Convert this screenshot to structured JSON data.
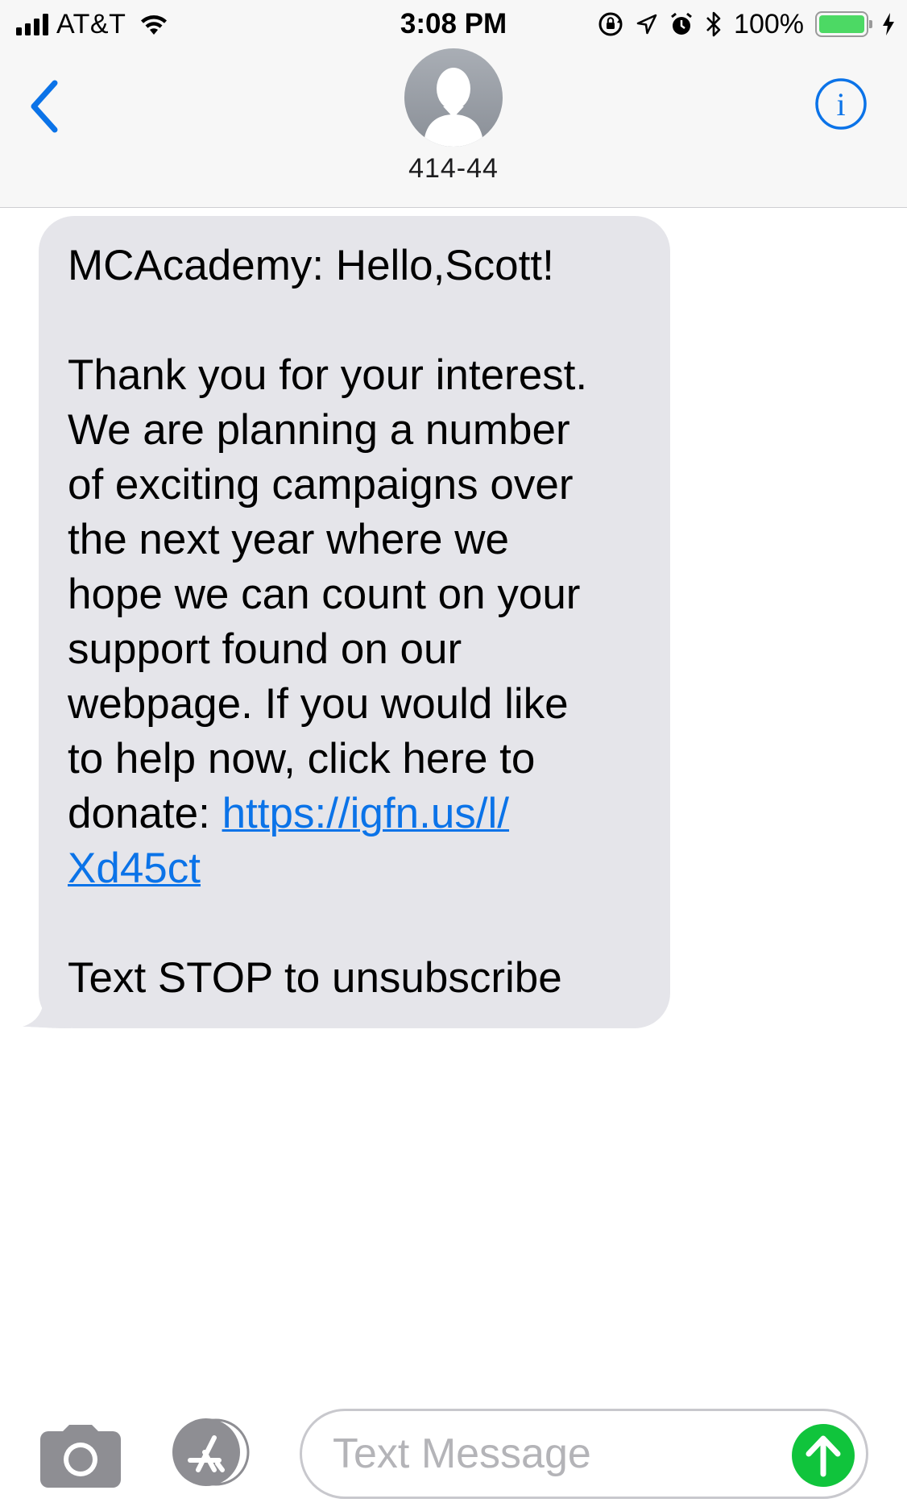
{
  "status_bar": {
    "carrier": "AT&T",
    "time": "3:08 PM",
    "battery_percent": "100%",
    "battery_level": 1.0,
    "icons": [
      "signal-icon",
      "wifi-icon",
      "rotation-lock-icon",
      "location-icon",
      "alarm-icon",
      "bluetooth-icon",
      "battery-icon",
      "charging-icon"
    ]
  },
  "nav": {
    "contact_name": "414-44",
    "back_icon": "chevron-left-icon",
    "info_icon": "info-icon",
    "avatar_icon": "person-silhouette-icon"
  },
  "message": {
    "sender_line": "MCAcademy: Hello,Scott!",
    "body_lines": [
      "Thank you for your interest.",
      "We are planning a number",
      "of exciting campaigns over",
      "the next year where we",
      "hope we can count on your",
      "support found on our",
      "webpage. If you would like",
      "to help now, click here to"
    ],
    "donate_prefix": "donate: ",
    "link_part1": "https://igfn.us/l/",
    "link_part2": "Xd45ct",
    "unsubscribe": "Text STOP to unsubscribe"
  },
  "input_bar": {
    "placeholder": "Text Message",
    "camera_icon": "camera-icon",
    "apps_icon": "app-store-icon",
    "send_icon": "arrow-up-icon"
  },
  "colors": {
    "accent": "#0b73e8",
    "bubble": "#e5e5ea",
    "send": "#10c43c",
    "battery": "#4cd964"
  }
}
